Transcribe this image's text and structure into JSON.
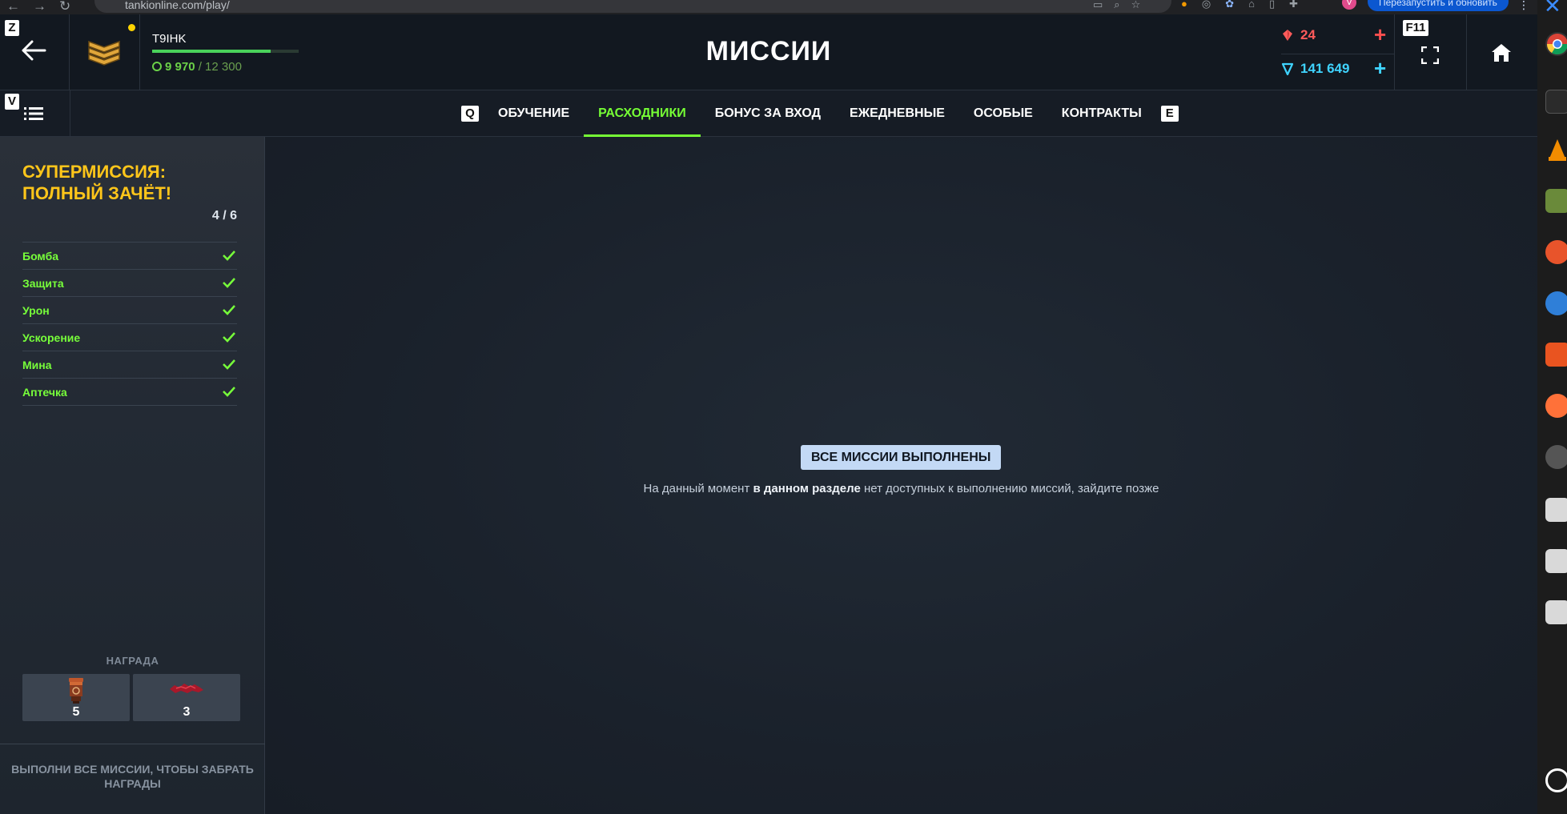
{
  "browser": {
    "url": "tankionline.com/play/",
    "relaunch_label": "Перезапустить и обновить"
  },
  "header": {
    "back_key": "Z",
    "player_name": "T9IHK",
    "xp_current": "9 970",
    "xp_max": "/ 12 300",
    "xp_progress": 0.81,
    "title": "МИССИИ",
    "crystals": "24",
    "tankoins": "141 649",
    "fullscreen_key": "F11",
    "menu_key": "V"
  },
  "tabs": {
    "prev_key": "Q",
    "next_key": "E",
    "items": [
      {
        "label": "ОБУЧЕНИЕ",
        "active": false
      },
      {
        "label": "РАСХОДНИКИ",
        "active": true
      },
      {
        "label": "БОНУС ЗА ВХОД",
        "active": false
      },
      {
        "label": "ЕЖЕДНЕВНЫЕ",
        "active": false
      },
      {
        "label": "ОСОБЫЕ",
        "active": false
      },
      {
        "label": "КОНТРАКТЫ",
        "active": false
      }
    ]
  },
  "supermission": {
    "title": "СУПЕРМИССИЯ: ПОЛНЫЙ ЗАЧЁТ!",
    "progress": "4 / 6",
    "items": [
      {
        "label": "Бомба",
        "done": true
      },
      {
        "label": "Защита",
        "done": true
      },
      {
        "label": "Урон",
        "done": true
      },
      {
        "label": "Ускорение",
        "done": true
      },
      {
        "label": "Мина",
        "done": true
      },
      {
        "label": "Аптечка",
        "done": true
      }
    ],
    "reward_label": "НАГРАДА",
    "rewards": [
      {
        "icon": "container-icon",
        "count": "5"
      },
      {
        "icon": "ruby-paint-icon",
        "count": "3"
      }
    ],
    "footer": "ВЫПОЛНИ ВСЕ МИССИИ, ЧТОБЫ ЗАБРАТЬ НАГРАДЫ"
  },
  "main": {
    "badge": "ВСЕ МИССИИ ВЫПОЛНЕНЫ",
    "message_prefix": "На данный момент ",
    "message_bold": "в данном разделе",
    "message_suffix": " нет доступных к выполнению миссий, зайдите позже"
  },
  "colors": {
    "accent_green": "#76ff35",
    "title_yellow": "#ffc61a",
    "crystal_red": "#ff5b5b",
    "tankoin_blue": "#3fd3ff"
  }
}
